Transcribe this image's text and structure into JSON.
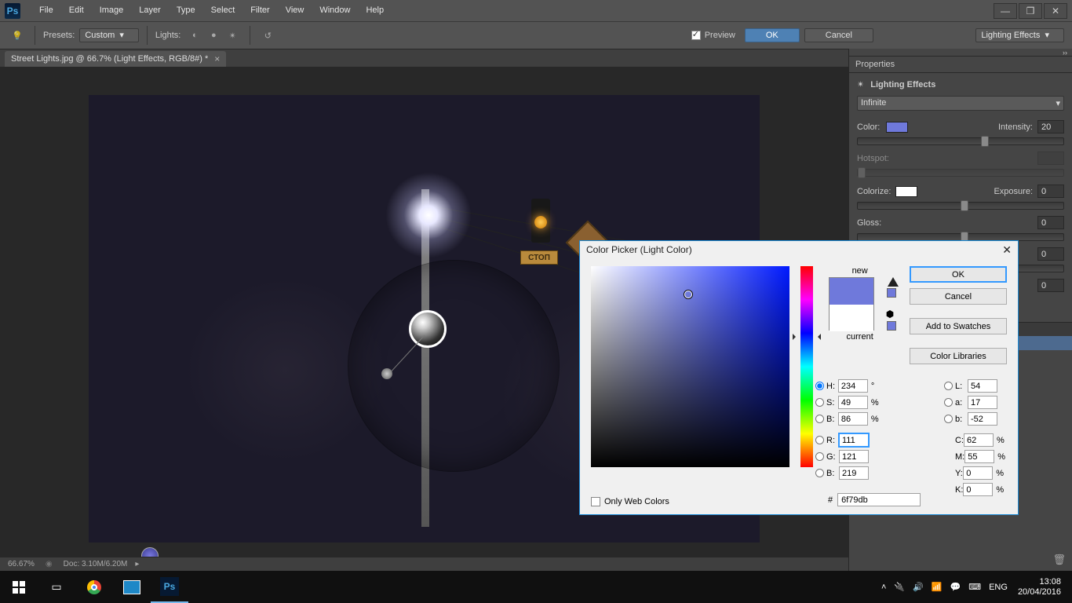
{
  "menubar": [
    "File",
    "Edit",
    "Image",
    "Layer",
    "Type",
    "Select",
    "Filter",
    "View",
    "Window",
    "Help"
  ],
  "options": {
    "presets_label": "Presets:",
    "presets_value": "Custom",
    "lights_label": "Lights:",
    "preview_label": "Preview",
    "ok": "OK",
    "cancel": "Cancel",
    "rightDropdown": "Lighting Effects"
  },
  "docTab": "Street Lights.jpg @ 66.7% (Light Effects, RGB/8#) *",
  "properties": {
    "panelTitle": "Properties",
    "effectTitle": "Lighting Effects",
    "lightType": "Infinite",
    "colorLabel": "Color:",
    "colorSwatch": "#6f79db",
    "intensityLabel": "Intensity:",
    "intensity": "20",
    "hotspotLabel": "Hotspot:",
    "colorizeLabel": "Colorize:",
    "colorizeSwatch": "#ffffff",
    "exposureLabel": "Exposure:",
    "exposure": "0",
    "glossLabel": "Gloss:",
    "gloss": "0",
    "metallic": "0",
    "ambience": "0"
  },
  "footer": {
    "zoom": "66.67%",
    "docinfo": "Doc: 3.10M/6.20M"
  },
  "colorPicker": {
    "title": "Color Picker (Light Color)",
    "newLabel": "new",
    "currentLabel": "current",
    "newColor": "#6f79db",
    "ok": "OK",
    "cancel": "Cancel",
    "addSwatches": "Add to Swatches",
    "colorLibraries": "Color Libraries",
    "H": "234",
    "S": "49",
    "Bval": "86",
    "R": "111",
    "G": "121",
    "Bch": "219",
    "L": "54",
    "a": "17",
    "b": "-52",
    "C": "62",
    "M": "55",
    "Y": "0",
    "K": "0",
    "hex": "6f79db",
    "webOnly": "Only Web Colors"
  },
  "sign": "СТОП",
  "taskbar": {
    "lang": "ENG",
    "time": "13:08",
    "date": "20/04/2016"
  }
}
